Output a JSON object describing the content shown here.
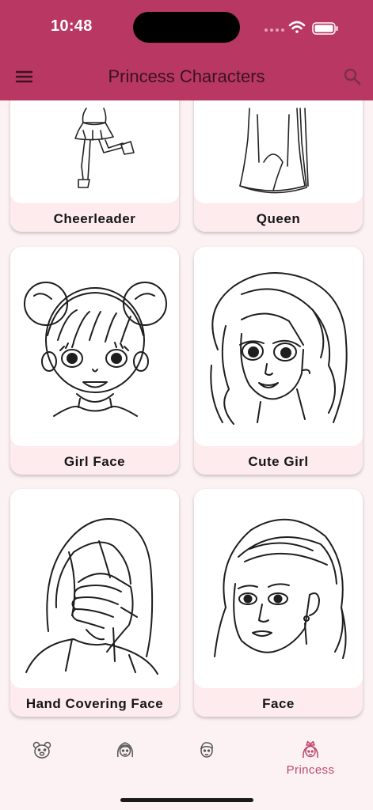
{
  "status_bar": {
    "time": "10:48"
  },
  "app_bar": {
    "title": "Princess Characters"
  },
  "cards": [
    {
      "label": "Cheerleader"
    },
    {
      "label": "Queen"
    },
    {
      "label": "Girl Face"
    },
    {
      "label": "Cute Girl"
    },
    {
      "label": "Hand Covering Face"
    },
    {
      "label": "Face"
    }
  ],
  "tabs": [
    {
      "icon": "bear-icon",
      "label": ""
    },
    {
      "icon": "girl-icon",
      "label": ""
    },
    {
      "icon": "boy-icon",
      "label": ""
    },
    {
      "icon": "princess-icon",
      "label": "Princess",
      "selected": true
    }
  ],
  "colors": {
    "app_bar": "#b83763",
    "accent": "#c0466f",
    "card_base": "#fdebee",
    "background": "#fcf2f4"
  }
}
